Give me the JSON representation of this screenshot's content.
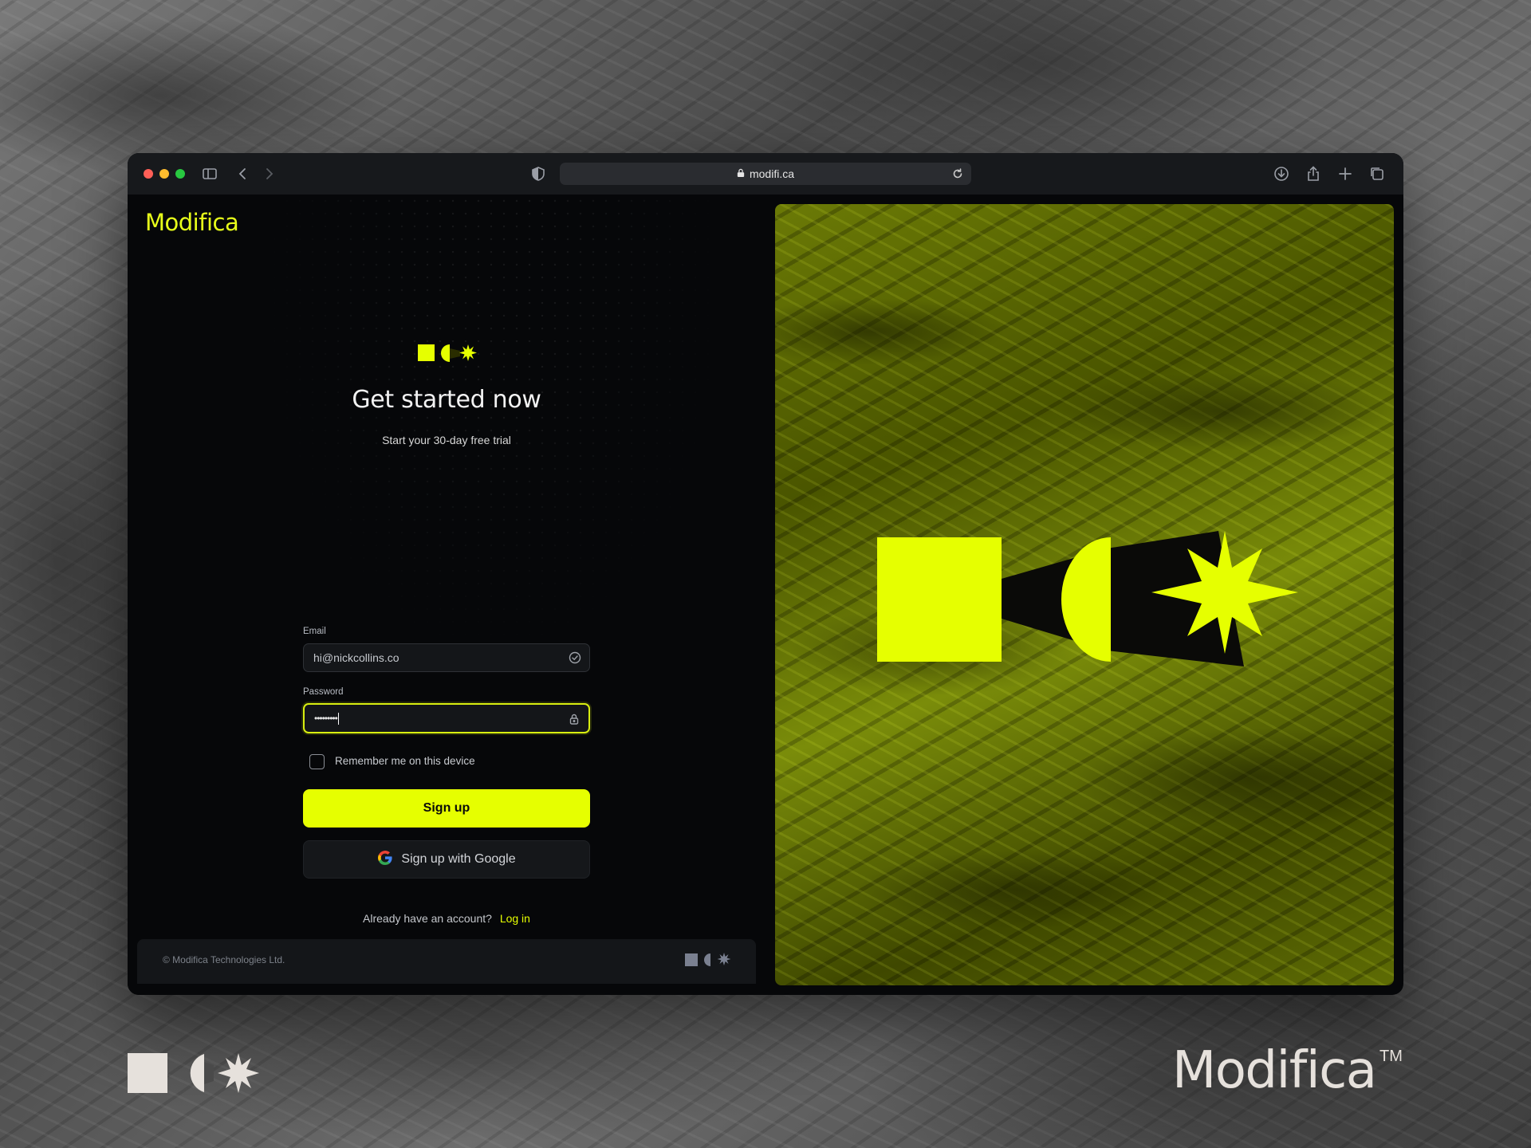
{
  "browser": {
    "url": "modifi.ca",
    "icons": [
      "sidebar-icon",
      "back-icon",
      "forward-icon",
      "shield-icon",
      "lock-icon",
      "reload-icon",
      "download-icon",
      "share-icon",
      "plus-icon",
      "tabs-icon"
    ]
  },
  "app": {
    "brand": "Modifica",
    "heading": "Get started now",
    "subheading": "Start your 30-day free trial",
    "form": {
      "email_label": "Email",
      "email_value": "hi@nickcollins.co",
      "password_label": "Password",
      "password_value": "•••••••••",
      "remember_label": "Remember me on this device",
      "remember_checked": false,
      "signup_label": "Sign up",
      "google_label": "Sign up with Google"
    },
    "login_prompt": "Already have an account?",
    "login_link": "Log in",
    "footer": {
      "copyright": "© Modifica Technologies Ltd."
    }
  },
  "colors": {
    "accent": "#e6ff00",
    "background": "#060709",
    "panel": "#141619"
  },
  "branding": {
    "wordmark": "Modifica",
    "trademark": "TM"
  }
}
